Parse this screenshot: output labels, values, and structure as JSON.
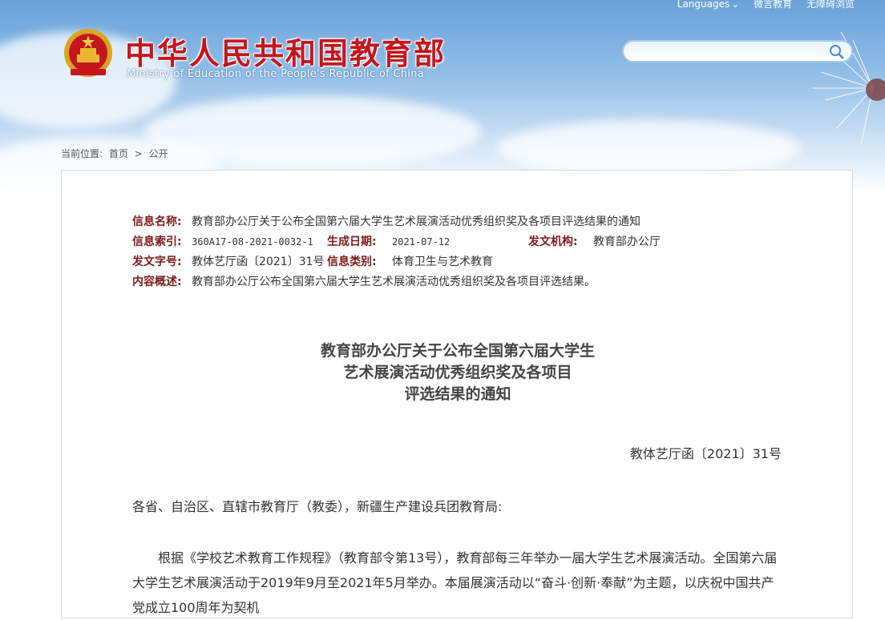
{
  "header": {
    "nav": [
      "Languages",
      "微言教育",
      "无障碍浏览"
    ],
    "title": "中华人民共和国教育部",
    "subtitle": "Ministry of Education of the People's Republic of China",
    "search_placeholder": ""
  },
  "breadcrumb": {
    "prefix": "当前位置:",
    "home": "首页",
    "separator": ">",
    "current": "公开"
  },
  "meta": {
    "name_label": "信息名称:",
    "name_value": "教育部办公厅关于公布全国第六届大学生艺术展演活动优秀组织奖及各项目评选结果的通知",
    "index_label": "信息索引:",
    "index_value": "360A17-08-2021-0032-1",
    "date_label": "生成日期:",
    "date_value": "2021-07-12",
    "org_label": "发文机构:",
    "org_value": "教育部办公厅",
    "docno_label": "发文字号:",
    "docno_value": "教体艺厅函〔2021〕31号",
    "category_label": "信息类别:",
    "category_value": "体育卫生与艺术教育",
    "summary_label": "内容概述:",
    "summary_value": "教育部办公厅公布全国第六届大学生艺术展演活动优秀组织奖及各项目评选结果。"
  },
  "document": {
    "title_lines": [
      "教育部办公厅关于公布全国第六届大学生",
      "艺术展演活动优秀组织奖及各项目",
      "评选结果的通知"
    ],
    "number": "教体艺厅函〔2021〕31号",
    "salutation": "各省、自治区、直辖市教育厅（教委），新疆生产建设兵团教育局:",
    "paragraph": "根据《学校艺术教育工作规程》（教育部令第13号），教育部每三年举办一届大学生艺术展演活动。全国第六届大学生艺术展演活动于2019年9月至2021年5月举办。本届展演活动以“奋斗·创新·奉献”为主题，以庆祝中国共产党成立100周年为契机"
  },
  "colors": {
    "title_red": "#c5161d",
    "label": "#7a1b1b",
    "sky": "#8dbbe6"
  }
}
